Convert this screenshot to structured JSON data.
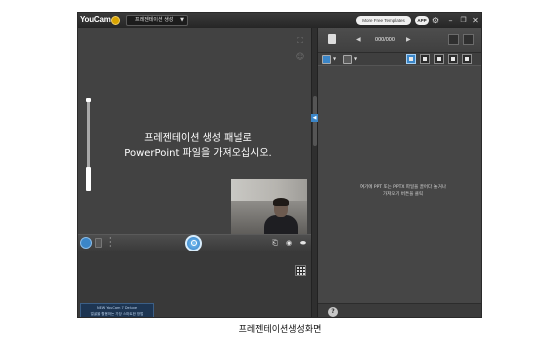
{
  "window": {
    "app_name": "YouCam",
    "mode_label": "프레젠테이션 생성",
    "free_templates_label": "More Free Templates",
    "app_badge": "APP"
  },
  "preview": {
    "message_line1": "프레젠테이션 생성 패널로",
    "message_line2": "PowerPoint 파일을 가져오십시오."
  },
  "promo": {
    "line1": "NEW YouCam 7 Deluxe",
    "line2": "얼굴을 활용하는 가장 스마트한 방법"
  },
  "slides": {
    "counter": "000/000",
    "hint_line1": "여기에 PPT 또는 PPTX 파일을 끌어다 놓거나",
    "hint_line2": "가져오기 버튼을 클릭"
  },
  "icons": [
    "logo-badge-icon",
    "dropdown-arrow-icon",
    "settings-icon",
    "minimize-icon",
    "restore-icon",
    "close-icon",
    "photo-mode-icon",
    "video-mode-icon",
    "more-icon",
    "capture-icon",
    "rotate-icon",
    "effects-icon",
    "eraser-icon",
    "grid-icon",
    "document-icon",
    "trash-icon",
    "layout-icon",
    "pen-icon",
    "highlighter-icon",
    "help-icon"
  ],
  "caption": "프레젠테이션생성화면",
  "colors": {
    "accent": "#3b86c8",
    "panel": "#3c3c3c",
    "badge": "#d9a300"
  }
}
